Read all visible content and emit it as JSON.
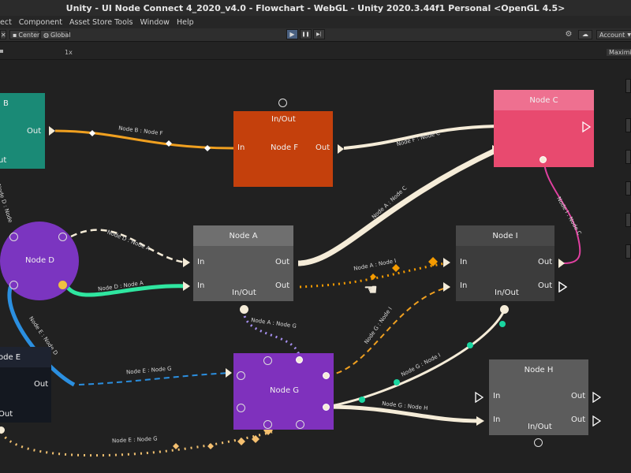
{
  "window": {
    "title": "Unity - UI Node Connect 4_2020_v4.0 - Flowchart - WebGL - Unity 2020.3.44f1 Personal <OpenGL 4.5>"
  },
  "menu": {
    "items": [
      "ect",
      "Component",
      "Asset Store Tools",
      "Window",
      "Help"
    ]
  },
  "toolbar": {
    "center_label": "Center",
    "global_label": "Global",
    "play_icon": "▶",
    "pause_icon": "❚❚",
    "step_icon": "▶|",
    "account_label": "Account",
    "scale_label": "1x",
    "maximize_label": "Maximize"
  },
  "colors": {
    "node_b": "#1a8a76",
    "node_f": "#c4400c",
    "node_c": "#e84a6f",
    "node_c_header": "#ee7090",
    "node_d": "#7b35c0",
    "node_a": "#5a5a5a",
    "node_a_header": "#6f6f6f",
    "node_i": "#3c3c3c",
    "node_i_header": "#484848",
    "node_e": "#141820",
    "node_e_header": "#1e2330",
    "node_g": "#7f31bd",
    "node_h": "#5c5c5c",
    "cream": "#f5ecd8",
    "orange": "#f0a020",
    "pink": "#e040a0",
    "green": "#2fe6a0",
    "blue": "#2b8fe0",
    "lavender": "#a68ff0",
    "wire_orange": "#f0a020",
    "teal": "#19d6a0",
    "dark_orange": "#f59b00"
  },
  "nodes": {
    "node_b": {
      "title": "B",
      "out": "Out",
      "partial": "ut"
    },
    "node_f": {
      "title": "Node F",
      "header": "In/Out",
      "in": "In",
      "out": "Out"
    },
    "node_c": {
      "title": "Node C"
    },
    "node_d": {
      "title": "Node D"
    },
    "node_a": {
      "title": "Node A",
      "in1": "In",
      "out1": "Out",
      "in2": "In",
      "out2": "Out",
      "inout": "In/Out"
    },
    "node_i": {
      "title": "Node I",
      "in1": "In",
      "out1": "Out",
      "in2": "In",
      "out2": "Out",
      "inout": "In/Out"
    },
    "node_e": {
      "title": "ode E",
      "out": "Out",
      "partial": "Out"
    },
    "node_g": {
      "title": "Node G"
    },
    "node_h": {
      "title": "Node H",
      "in1": "In",
      "out1": "Out",
      "in2": "In",
      "out2": "Out",
      "inout": "In/Out"
    }
  },
  "connections": {
    "b_f": "Node B : Node F",
    "f_c": "Node F : Node C",
    "a_c": "Node A : Node C",
    "d_a_dashed": "Node D : Node A",
    "d_a_solid": "Node D : Node A",
    "a_i": "Node A : Node I",
    "i_c": "Node I : Node C",
    "d_partial": "Node D : Node",
    "e_d": "Node E : Node D",
    "a_g": "Node A : Node G",
    "g_i": "Node G : Node I",
    "g_i2": "Node G : Node I",
    "e_g": "Node E : Node G",
    "e_g2": "Node E : Node G",
    "g_h": "Node G : Node H"
  }
}
